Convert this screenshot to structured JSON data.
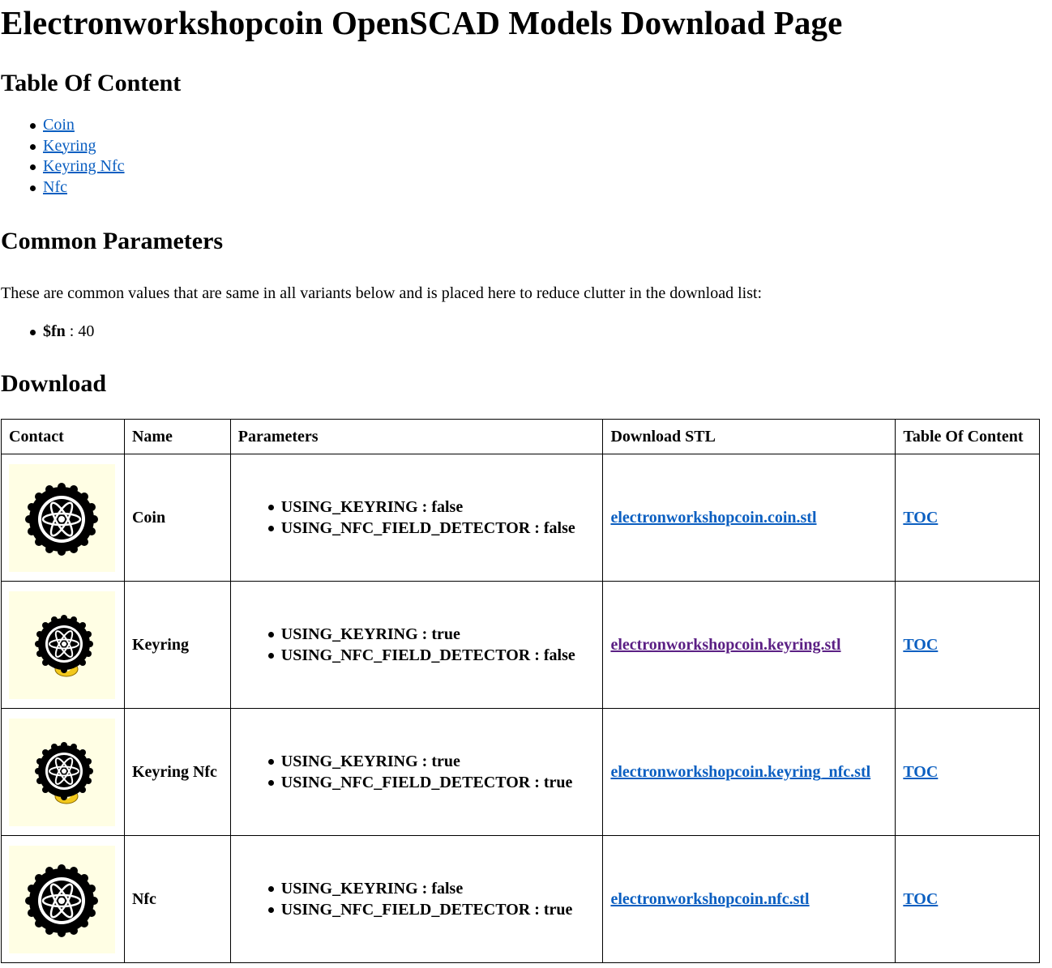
{
  "page": {
    "title": "Electronworkshopcoin OpenSCAD Models Download Page"
  },
  "toc": {
    "title": "Table Of Content",
    "items": [
      {
        "label": "Coin"
      },
      {
        "label": "Keyring"
      },
      {
        "label": "Keyring Nfc"
      },
      {
        "label": "Nfc"
      }
    ]
  },
  "common": {
    "title": "Common Parameters",
    "text": "These are common values that are same in all variants below and is placed here to reduce clutter in the download list:",
    "params": [
      {
        "name": "$fn",
        "sep": " : ",
        "value": "40"
      }
    ]
  },
  "download": {
    "title": "Download",
    "headers": [
      "Contact",
      "Name",
      "Parameters",
      "Download STL",
      "Table Of Content"
    ],
    "rows": [
      {
        "name": "Coin",
        "params": [
          "USING_KEYRING : false",
          "USING_NFC_FIELD_DETECTOR : false"
        ],
        "stl": "electronworkshopcoin.coin.stl",
        "toc": "TOC"
      },
      {
        "name": "Keyring",
        "params": [
          "USING_KEYRING : true",
          "USING_NFC_FIELD_DETECTOR : false"
        ],
        "stl": "electronworkshopcoin.keyring.stl",
        "toc": "TOC"
      },
      {
        "name": "Keyring Nfc",
        "params": [
          "USING_KEYRING : true",
          "USING_NFC_FIELD_DETECTOR : true"
        ],
        "stl": "electronworkshopcoin.keyring_nfc.stl",
        "toc": "TOC"
      },
      {
        "name": "Nfc",
        "params": [
          "USING_KEYRING : false",
          "USING_NFC_FIELD_DETECTOR : true"
        ],
        "stl": "electronworkshopcoin.nfc.stl",
        "toc": "TOC"
      }
    ]
  },
  "colors": {
    "link": "#0b5fc1",
    "visited_link": "#5b1f84",
    "thumb_bg": "#fffee4",
    "keyring_ring": "#f2c81c"
  },
  "icons": [
    "coin-gear-atom-icon",
    "keyring-gear-atom-icon"
  ]
}
